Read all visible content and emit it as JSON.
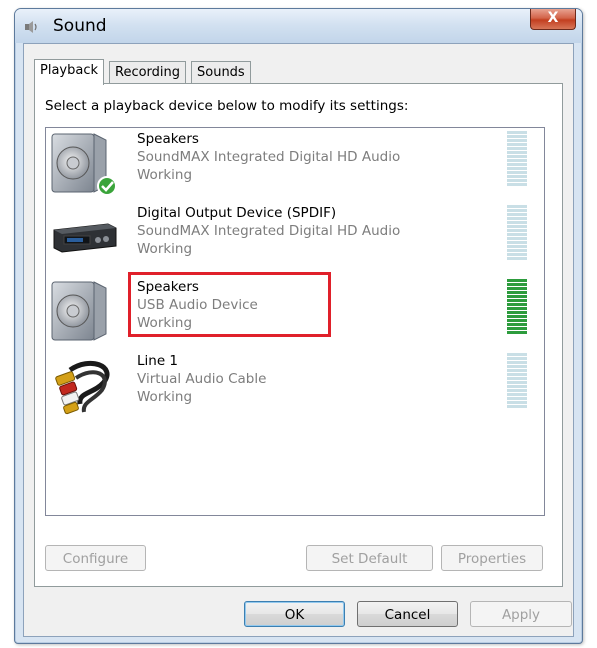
{
  "window": {
    "title": "Sound",
    "close_label": "X"
  },
  "tabs": [
    {
      "label": "Playback",
      "active": true
    },
    {
      "label": "Recording",
      "active": false
    },
    {
      "label": "Sounds",
      "active": false
    }
  ],
  "instruction": "Select a playback device below to modify its settings:",
  "devices": [
    {
      "name": "Speakers",
      "driver": "SoundMAX Integrated Digital HD Audio",
      "status": "Working",
      "icon": "speaker-default-icon",
      "is_default": true,
      "level_active": false
    },
    {
      "name": "Digital Output Device (SPDIF)",
      "driver": "SoundMAX Integrated Digital HD Audio",
      "status": "Working",
      "icon": "digital-output-device-icon",
      "is_default": false,
      "level_active": false
    },
    {
      "name": "Speakers",
      "driver": "USB Audio Device",
      "status": "Working",
      "icon": "speaker-icon",
      "is_default": false,
      "level_active": true,
      "highlighted": true
    },
    {
      "name": "Line 1",
      "driver": "Virtual Audio Cable",
      "status": "Working",
      "icon": "rca-cable-icon",
      "is_default": false,
      "level_active": false
    }
  ],
  "panel_buttons": {
    "configure": "Configure",
    "set_default": "Set Default",
    "properties": "Properties"
  },
  "dialog_buttons": {
    "ok": "OK",
    "cancel": "Cancel",
    "apply": "Apply"
  },
  "colors": {
    "highlight": "#e0202a",
    "meter_active": "#2d9c3d",
    "meter_idle": "#c9dfe6"
  }
}
